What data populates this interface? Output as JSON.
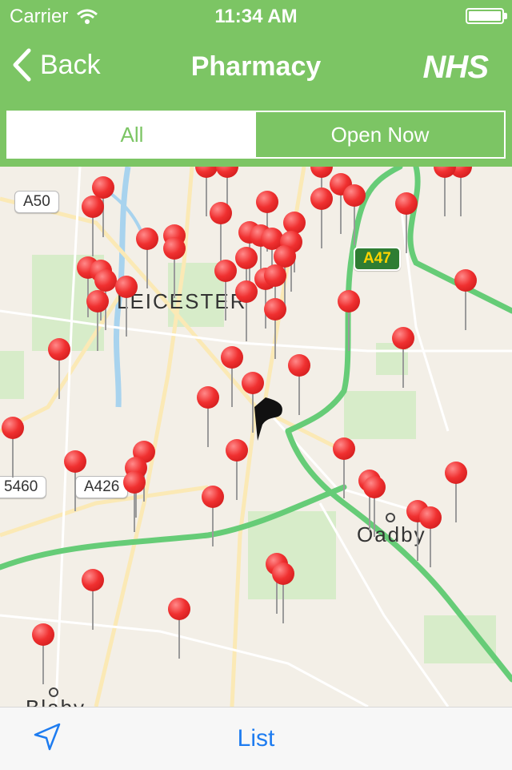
{
  "status_bar": {
    "carrier": "Carrier",
    "time": "11:34 AM"
  },
  "nav": {
    "back_label": "Back",
    "title": "Pharmacy",
    "logo_text": "NHS"
  },
  "segment": {
    "options": [
      "All",
      "Open Now"
    ],
    "selected": "All"
  },
  "map": {
    "place_labels": [
      "LEICESTER",
      "Oadby",
      "Blaby"
    ],
    "road_labels": [
      "A50",
      "A47",
      "A426",
      "5460"
    ]
  },
  "tabbar": {
    "list_label": "List"
  },
  "colors": {
    "header_green": "#7cc564",
    "pin_red": "#f03030",
    "ios_blue": "#1e7cf0",
    "route_green": "#66cc77"
  }
}
